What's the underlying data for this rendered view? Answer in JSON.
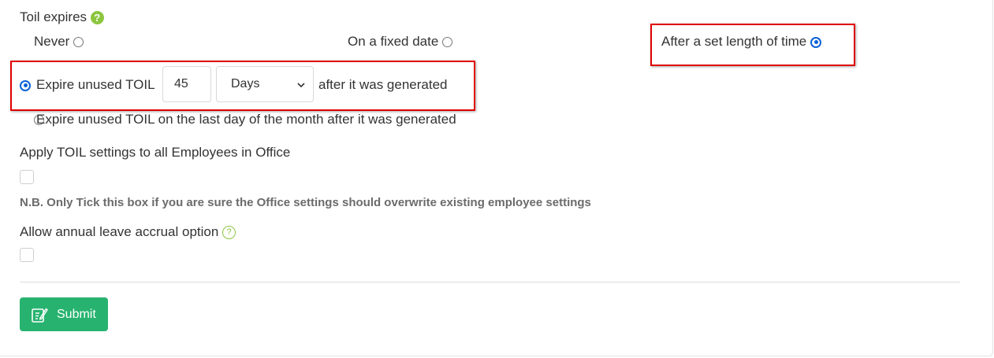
{
  "toil_expires": {
    "label": "Toil expires",
    "help_icon": "question-circle-icon",
    "options": [
      {
        "label": "Never",
        "checked": false
      },
      {
        "label": "On a fixed date",
        "checked": false
      },
      {
        "label": "After a set length of time",
        "checked": true
      }
    ]
  },
  "expiry_modes": {
    "after_length": {
      "prefix": "Expire unused TOIL",
      "amount": "45",
      "unit_selected": "Days",
      "suffix": "after it was generated",
      "checked": true
    },
    "end_of_month": {
      "label": "Expire unused TOIL on the last day of the month after it was generated",
      "checked": false
    }
  },
  "apply_all": {
    "label": "Apply TOIL settings to all Employees in Office",
    "checked": false,
    "note": "N.B. Only Tick this box if you are sure the Office settings should overwrite existing employee settings"
  },
  "annual_leave": {
    "label": "Allow annual leave accrual option",
    "help_icon": "question-circle-outline-icon",
    "checked": false
  },
  "submit": {
    "label": "Submit",
    "icon": "edit-icon",
    "color": "#27b36f"
  },
  "colors": {
    "highlight": "#e00000",
    "radio_accent": "#0b61d6",
    "help_green": "#8cc63f"
  }
}
